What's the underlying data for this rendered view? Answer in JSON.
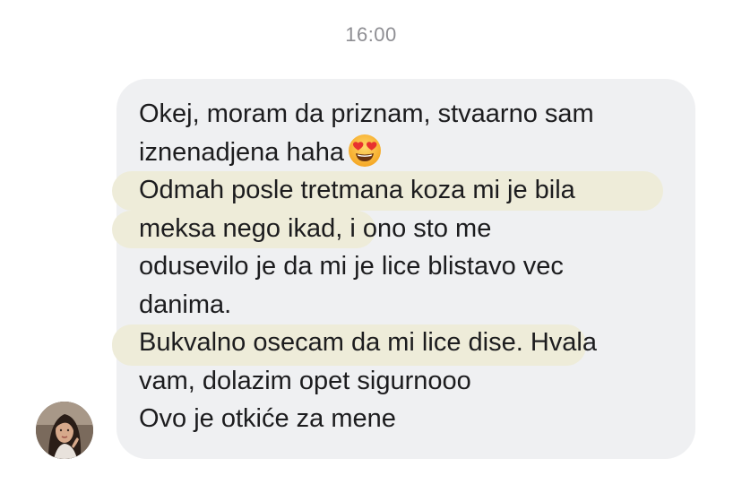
{
  "conversation": {
    "timestamp": "16:00",
    "message": {
      "lines": [
        "Okej, moram da priznam, stvaarno sam",
        "iznenadjena haha",
        "Odmah posle tretmana koza mi je bila",
        "meksa nego ikad,",
        " i ono sto me",
        "odusevilo je da mi je lice blistavo vec",
        "danima.",
        "Bukvalno osecam da mi lice dise.",
        " Hvala",
        "vam, dolazim opet sigurnooo",
        "Ovo je otkiće za mene"
      ],
      "emoji": "heart-eyes-emoji",
      "highlight_color": "#eeecd9",
      "bubble_color": "#eff0f2"
    },
    "sender": {
      "avatar": "avatar-photo"
    }
  }
}
